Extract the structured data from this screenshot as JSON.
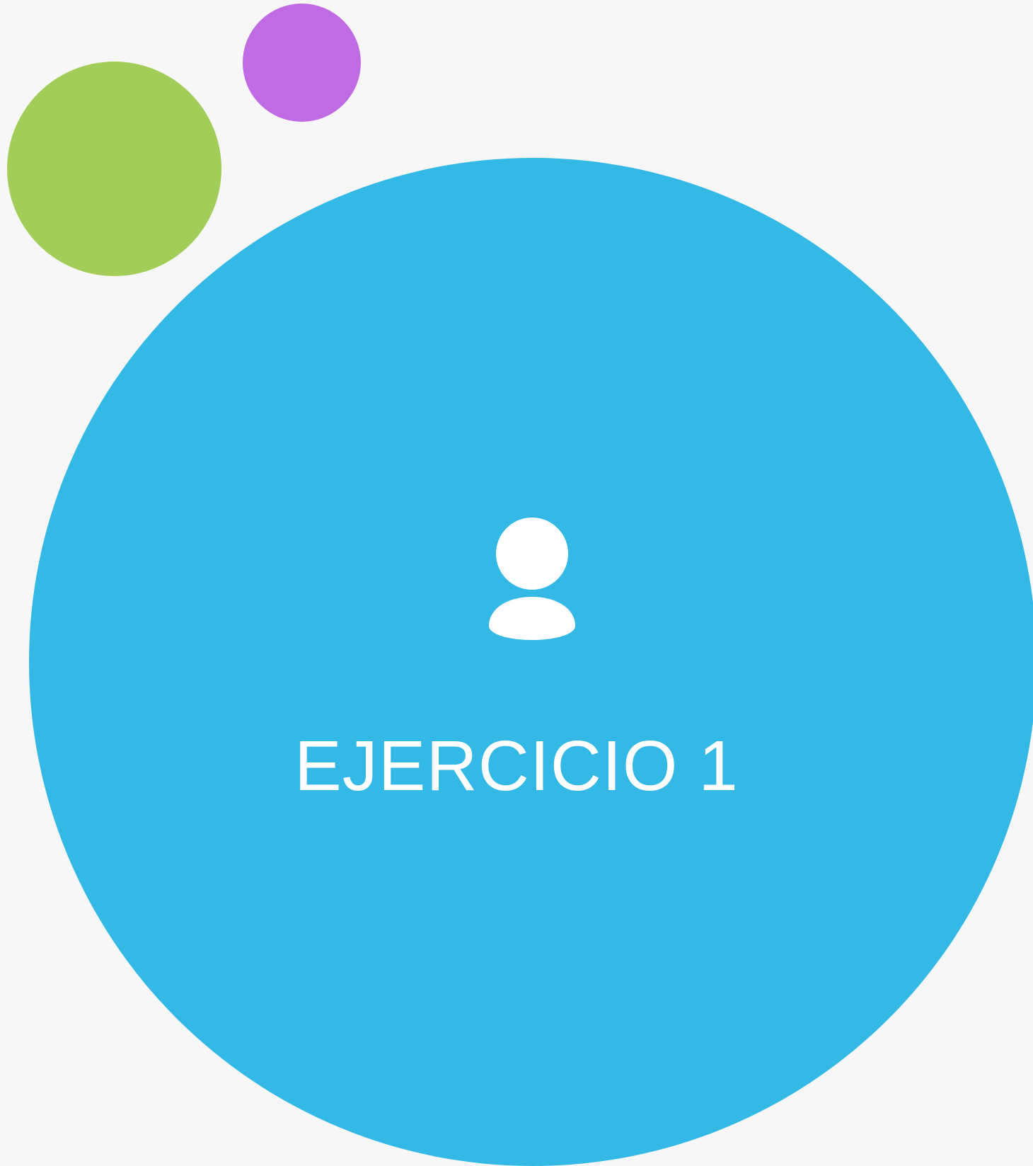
{
  "slide": {
    "title": "EJERCICIO 1",
    "icon": "user-icon"
  },
  "colors": {
    "background": "#f7f7f7",
    "green_circle": "#a1cd58",
    "purple_circle": "#c06ae3",
    "blue_circle": "#34b9e6",
    "text": "#ffffff"
  }
}
